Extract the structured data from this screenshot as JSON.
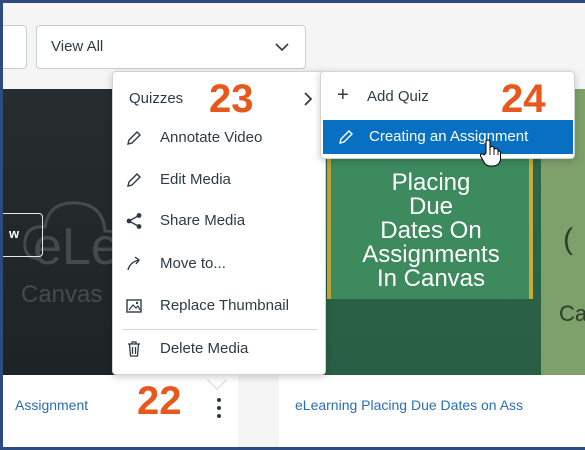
{
  "filter": {
    "selected": "View All"
  },
  "cards": [
    {
      "title": "Assignment",
      "thumb_word": "eLea",
      "thumb_sub": "Canvas",
      "badge": "w"
    },
    {
      "title": "eLearning Placing Due Dates on Ass",
      "thumb_lines": [
        "Placing",
        "Due",
        "Dates On",
        "Assignments",
        "In Canvas"
      ],
      "side_sub": "Ca",
      "side_glyph": "("
    }
  ],
  "menu": {
    "items": [
      {
        "label": "Quizzes",
        "icon": "none",
        "has_submenu": true
      },
      {
        "label": "Annotate Video",
        "icon": "pencil-icon"
      },
      {
        "label": "Edit Media",
        "icon": "pencil-icon"
      },
      {
        "label": "Share Media",
        "icon": "share-icon"
      },
      {
        "label": "Move to...",
        "icon": "move-arrow-icon"
      },
      {
        "label": "Replace Thumbnail",
        "icon": "image-icon"
      },
      {
        "label": "Delete Media",
        "icon": "trash-icon"
      }
    ]
  },
  "submenu": {
    "add_quiz": "Add Quiz",
    "creating": "Creating an Assignment"
  },
  "steps": {
    "s22": "22",
    "s23": "23",
    "s24": "24"
  },
  "colors": {
    "accent": "#0870c2",
    "step": "#e8571b",
    "link": "#2a6fb5",
    "frame": "#2d4b7e"
  }
}
